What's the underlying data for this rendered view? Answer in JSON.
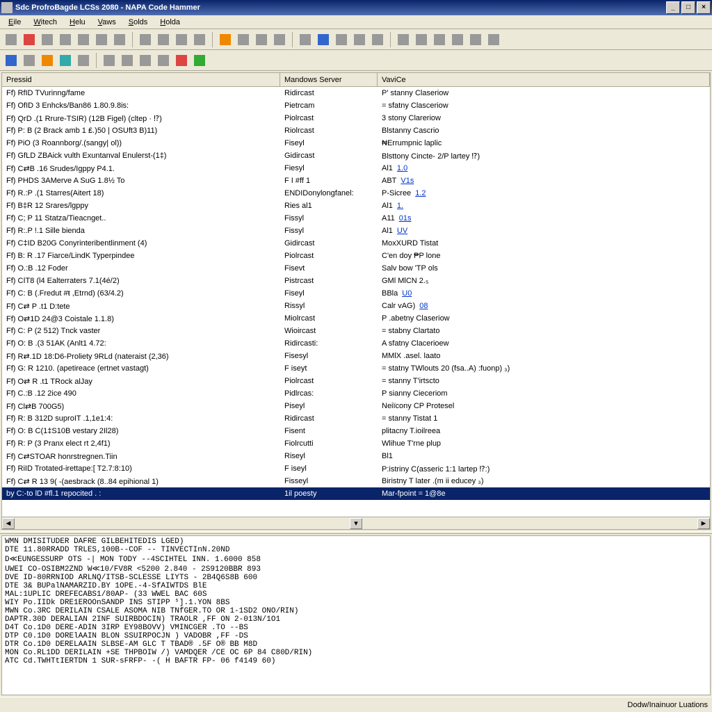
{
  "title": "Sdc ProfroBagde LCSs 2080 - NAPA Code Hammer",
  "menu": [
    "Eile",
    "Witech",
    "Helu",
    "Vaws",
    "Solds",
    "Holda"
  ],
  "columns": {
    "c1": "Pressid",
    "c2": "Mandows Server",
    "c3": "VaviCe"
  },
  "rows": [
    {
      "c1": "Ff) RfID TVurinng/fame",
      "c2": "Ridircast",
      "c3": "P' stanny Claseriow"
    },
    {
      "c1": "Ff) OfID 3 Enhcks/Ban86 1.80.9.8is:",
      "c2": "Pietrcam",
      "c3": "= sfatny Clasceriow"
    },
    {
      "c1": "Ff) QrD .(1 Rrure-TSIR) (12B Figel) (cltep · ⁉)",
      "c2": "Piolrcast",
      "c3": "3 stony Clareriow"
    },
    {
      "c1": "Ff) P: B (2 Brack amb 1 ₤.)50 | OSUft3 B)11)",
      "c2": "Riolrcast",
      "c3": "Blstanny Cascrio"
    },
    {
      "c1": "Ff) PiO (3 Roannborg/.(sangy| ol))",
      "c2": "Fiseyl",
      "c3": "₦Errumpnic laplic"
    },
    {
      "c1": "Ff) GfLD ZBAick vulth Exuntanval Enulerst-(1‡)",
      "c2": "Gidircast",
      "c3": "Blsttony Cincte- 2/P lartey ⁉)"
    },
    {
      "c1": "Ff) C⇄B .16 Srudes/Igppy P4.1.",
      "c2": "Fiesyl",
      "c3": "Al1",
      "link": "1.0"
    },
    {
      "c1": "Ff) PHDS 3AMerve A SuG 1.8½ To",
      "c2": "F I #ff 1",
      "c3": "ABT",
      "link": "V1s"
    },
    {
      "c1": "Ff) R.:P .(1 Starres(Aitert 18)",
      "c2": "ENDIDonylongfanel:",
      "c3": "P-Sicree",
      "link": "1.2"
    },
    {
      "c1": "Ff) B‡R 12 Srares/lgppy",
      "c2": "Ries al1",
      "c3": "Al1",
      "link": "1."
    },
    {
      "c1": "Ff) C; P 11 Statza/Tieacnget..",
      "c2": "Fissyl",
      "c3": "A11",
      "link": "01s"
    },
    {
      "c1": "Ff) R:.P !.1 Sille bienda",
      "c2": "Fissyl",
      "c3": "Al1",
      "link": "UV"
    },
    {
      "c1": "Ff) C‡ID B20G Conyrinteribentlinment (4)",
      "c2": "Gidircast",
      "c3": "MoxXURD Tistat"
    },
    {
      "c1": "Ff) B: R .17 Fiarce/LindK Typerpindee",
      "c2": "Piolrcast",
      "c3": "C'en doy ₱P lone"
    },
    {
      "c1": "Ff) O.:B .12 Foder",
      "c2": "Fisevt",
      "c3": "Salv bow 'TP ols"
    },
    {
      "c1": "Ff) CİT8 (l4 Ealterraters 7.1(4é/2)",
      "c2": "Pistrcast",
      "c3": "GMl MlCN 2.₅"
    },
    {
      "c1": "Ff) C: B (.Fredut #ŧ ,Etrnd) (63/4.2)",
      "c2": "Fiseyl",
      "c3": "BBla",
      "link": "U0"
    },
    {
      "c1": "Ff) C⇄ P .t1 D:tete",
      "c2": "Rissyl",
      "c3": "Calr vAG)",
      "link": "08"
    },
    {
      "c1": "Ff) O⇄1D 24@3 Coistale 1.1.8)",
      "c2": "Miolrcast",
      "c3": "P .abetny Claseriow"
    },
    {
      "c1": "Ff) C: P (2 512) Tnck vaster",
      "c2": "Wioircast",
      "c3": "= stabny Clartato"
    },
    {
      "c1": "Ff) O: B .(3 51AK (Anlt1 4.72:",
      "c2": "Ridircasti:",
      "c3": "A sfatny Clacerioew"
    },
    {
      "c1": "Ff) R⇄.1D 18:D6-Proliety 9RLd (nateraist (2,36)",
      "c2": "Fisesyl",
      "c3": "MMlX .asel. laato"
    },
    {
      "c1": "Ff) G: R 1210. (apetireace (ertnet vastagt)",
      "c2": "F iseyt",
      "c3": "= statny TWlouts 20 (fsa..A) :fuonp) ₃)"
    },
    {
      "c1": "Ff) O⇄ R .t1 TRock alJay",
      "c2": "Piolrcast",
      "c3": "= stanny T'irtscto"
    },
    {
      "c1": "Ff) C.:B .12 2ice 490",
      "c2": "Pidlrcas:",
      "c3": "P sianny Cieceriom"
    },
    {
      "c1": "Ff) Cl⇄B 700G5)",
      "c2": "Piseyl",
      "c3": "Neiïcony CP Protesel"
    },
    {
      "c1": "Ff) R: B 312D suproIT .1,1e1:4:",
      "c2": "Ridircast",
      "c3": "= stanny Tistat 1"
    },
    {
      "c1": "Ff) O: B C(1‡S10B vestary 2Il28)",
      "c2": "Fisent",
      "c3": "plitacny T.ioilreea"
    },
    {
      "c1": "Ff) R: P (3 Pranx elect rt 2,4f1)",
      "c2": "Fiolrcutti",
      "c3": "Wlihue T'rne plup"
    },
    {
      "c1": "Ff) C⇄STOAR honrstregnen.Tiin",
      "c2": "Riseyl",
      "c3": "Bl1"
    },
    {
      "c1": "Ff) RiID Trotated-irettape:[ T2.7:8:10)",
      "c2": "F iseyl",
      "c3": "P:istriny C(asseric 1:1 lartep ⁉:)"
    },
    {
      "c1": "Ff) C⇄ R 13 9( -(aesbrack (8..84 epihional 1)",
      "c2": "Fisseyl",
      "c3": "Biristny T later .(m ii educey ₃)"
    },
    {
      "c1": "by C:-to lD #fl.1 repocited . :",
      "c2": "1il poesty",
      "c3": "Mar-fpoint = 1@8e",
      "sel": true
    }
  ],
  "log": "WMN DMISITUDER DAFRE GILBEHITEDIS LGED)\nDTE 11.80RRADD TRLES,100B--COF -- TINVECTInN.20ND\nD≪EUNGESSURP OTS -| MON TODY --4SCIHTEL INN. 1.6000 858\nUWEI CO-OSIBM2ZND W≪10/FV8R <5200 2.840 - 2S9120BBR 893\nDVE ID-80RRNIOD ARLNQ/ITSB-SCLESSE LIYTS - 2B4Q6S8B 600\nDTE 3& BUPalNAMARZID.BY 1OPE.-4-SfAIWTDS BlE\nMAL:1UPLIC DREFECABS1/80AP- (33 WWEL BAC 60S\nWIY Po.IIDk DRE1EROOnSANDP INS STIPP ⁵].1.YON 8BS\nMWN Co.3RC DERILAIN CSALE ASOMA NIB TNfGER.TO OR 1-1SD2 ONO/RIN)\nDAPTR.30D DERALIAN 2INF SUIRBDOCIN) TRAOLR ,FF ON 2-013N/1O1\nD4T Co.1D0 DERE-ADIN 3IRP EY98BOVV) VMINCGER .TO --BS\nDTP C0.1D0 DORElAAIN BLON SSUIRPOCJN ) VADOBR ,FF -DS\nDTR Co.1D0 DERELAAIN SLBSE-AM GLC T TBAD® .5F O® BB M8D\nMON Co.RL1DD DERILAIN +SE THPBOIW /) VAMDQER /CE OC 6P 84 C80D/RIN)\nATC Cd.TWHTtIERTDN 1 SUR-sFRFP- -( H BAFTR FP- 06 f4149 60)",
  "status": "Dodw/Inainuor Luations",
  "icons": [
    [
      "gray",
      "red",
      "gray",
      "gray",
      "gray",
      "gray",
      "gray",
      "sep",
      "gray",
      "gray",
      "gray",
      "gray",
      "sep",
      "orange",
      "gray",
      "gray",
      "gray",
      "sep",
      "gray",
      "blue",
      "gray",
      "gray",
      "gray",
      "sep",
      "gray",
      "gray",
      "gray",
      "gray",
      "gray",
      "gray"
    ],
    [
      "blue",
      "gray",
      "orange",
      "teal",
      "gray",
      "sep",
      "gray",
      "gray",
      "gray",
      "gray",
      "red",
      "green"
    ]
  ]
}
